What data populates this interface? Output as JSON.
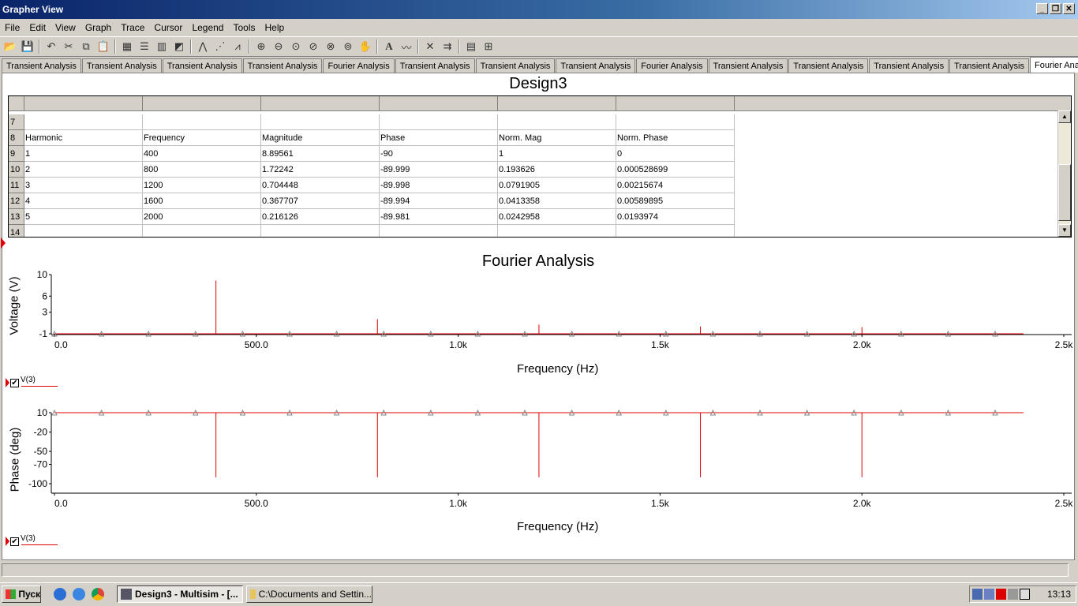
{
  "window": {
    "title": "Grapher View",
    "buttons": [
      "_",
      "❐",
      "✕"
    ]
  },
  "menu": [
    "File",
    "Edit",
    "View",
    "Graph",
    "Trace",
    "Cursor",
    "Legend",
    "Tools",
    "Help"
  ],
  "tabs": [
    {
      "label": "Transient Analysis"
    },
    {
      "label": "Transient Analysis"
    },
    {
      "label": "Transient Analysis"
    },
    {
      "label": "Transient Analysis"
    },
    {
      "label": "Fourier Analysis"
    },
    {
      "label": "Transient Analysis"
    },
    {
      "label": "Transient Analysis"
    },
    {
      "label": "Transient Analysis"
    },
    {
      "label": "Fourier Analysis"
    },
    {
      "label": "Transient Analysis"
    },
    {
      "label": "Transient Analysis"
    },
    {
      "label": "Transient Analysis"
    },
    {
      "label": "Transient Analysis"
    },
    {
      "label": "Fourier Analysis",
      "active": true
    }
  ],
  "design_title": "Design3",
  "table": {
    "rows": [
      {
        "num": "7",
        "cells": [
          "",
          "",
          "",
          "",
          "",
          ""
        ]
      },
      {
        "num": "8",
        "cells": [
          "Harmonic",
          "Frequency",
          "Magnitude",
          "Phase",
          "Norm. Mag",
          "Norm. Phase"
        ]
      },
      {
        "num": "9",
        "cells": [
          "1",
          "400",
          "8.89561",
          "-90",
          "1",
          "0"
        ]
      },
      {
        "num": "10",
        "cells": [
          "2",
          "800",
          "1.72242",
          "-89.999",
          "0.193626",
          "0.000528699"
        ]
      },
      {
        "num": "11",
        "cells": [
          "3",
          "1200",
          "0.704448",
          "-89.998",
          "0.0791905",
          "0.00215674"
        ]
      },
      {
        "num": "12",
        "cells": [
          "4",
          "1600",
          "0.367707",
          "-89.994",
          "0.0413358",
          "0.00589895"
        ]
      },
      {
        "num": "13",
        "cells": [
          "5",
          "2000",
          "0.216126",
          "-89.981",
          "0.0242958",
          "0.0193974"
        ]
      },
      {
        "num": "14",
        "cells": [
          "",
          "",
          "",
          "",
          "",
          ""
        ]
      }
    ]
  },
  "chart_data": [
    {
      "type": "bar",
      "title": "Fourier Analysis",
      "xlabel": "Frequency (Hz)",
      "ylabel": "Voltage (V)",
      "xlim": [
        0,
        2500
      ],
      "ylim": [
        -1,
        10
      ],
      "xticks": [
        "0.0",
        "500.0",
        "1.0k",
        "1.5k",
        "2.0k",
        "2.5k"
      ],
      "xtick_values": [
        0,
        500,
        1000,
        1500,
        2000,
        2500
      ],
      "yticks": [
        "10",
        "6",
        "3",
        "-1"
      ],
      "ytick_values": [
        10,
        6,
        3,
        -1
      ],
      "x": [
        400,
        800,
        1200,
        1600,
        2000
      ],
      "series": [
        {
          "name": "V(3)",
          "values": [
            8.89561,
            1.72242,
            0.704448,
            0.367707,
            0.216126
          ],
          "color": "#e00000"
        }
      ],
      "baseline": -1,
      "x_end": 2400
    },
    {
      "type": "bar",
      "xlabel": "Frequency (Hz)",
      "ylabel": "Phase (deg)",
      "xlim": [
        0,
        2500
      ],
      "ylim": [
        -100,
        10
      ],
      "xticks": [
        "0.0",
        "500.0",
        "1.0k",
        "1.5k",
        "2.0k",
        "2.5k"
      ],
      "xtick_values": [
        0,
        500,
        1000,
        1500,
        2000,
        2500
      ],
      "yticks": [
        "10",
        "-20",
        "-50",
        "-70",
        "-100"
      ],
      "ytick_values": [
        10,
        -20,
        -50,
        -70,
        -100
      ],
      "x": [
        400,
        800,
        1200,
        1600,
        2000
      ],
      "series": [
        {
          "name": "V(3)",
          "values": [
            -90,
            -89.999,
            -89.998,
            -89.994,
            -89.981
          ],
          "color": "#e00000"
        }
      ],
      "baseline": 10,
      "x_end": 2400
    }
  ],
  "taskbar": {
    "start_label": "Пуск",
    "tasks": [
      {
        "label": "Design3 - Multisim - [...",
        "active": true
      },
      {
        "label": "C:\\Documents and Settin...",
        "active": false
      }
    ],
    "clock": "13:13"
  }
}
